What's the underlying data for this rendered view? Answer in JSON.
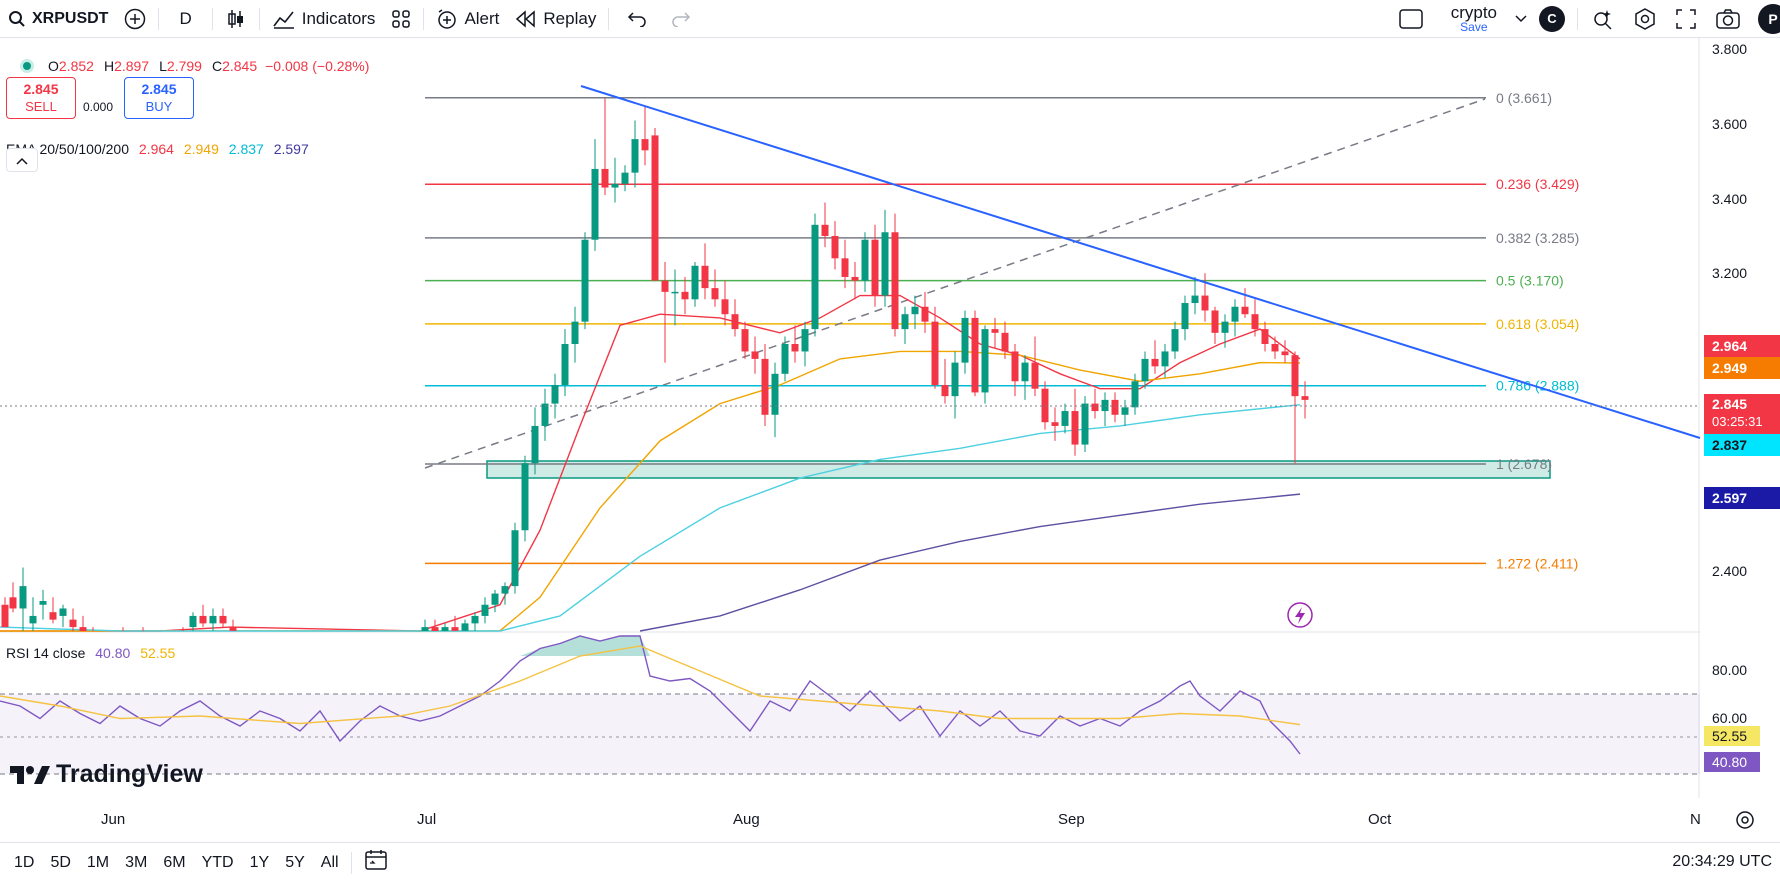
{
  "toolbar": {
    "symbol": "XRPUSDT",
    "interval": "D",
    "indicators_label": "Indicators",
    "alert_label": "Alert",
    "replay_label": "Replay",
    "layout_name": "crypto",
    "layout_save": "Save",
    "avatar_letter": "C",
    "avatar2_letter": "P"
  },
  "legend": {
    "open_label": "O",
    "open": "2.852",
    "high_label": "H",
    "high": "2.897",
    "low_label": "L",
    "low": "2.799",
    "close_label": "C",
    "close": "2.845",
    "change": "−0.008 (−0.28%)",
    "sell_price": "2.845",
    "sell_label": "SELL",
    "spread": "0.000",
    "buy_price": "2.845",
    "buy_label": "BUY",
    "ema_name": "EMA 20/50/100/200",
    "ema20": "2.964",
    "ema50": "2.949",
    "ema100": "2.837",
    "ema200": "2.597",
    "rsi_name": "RSI 14 close",
    "rsi_value": "40.80",
    "rsi_ma": "52.55",
    "collapse_icon": "chevron-up-icon"
  },
  "price_scale": {
    "labels": [
      "3.800",
      "3.600",
      "3.400",
      "3.200",
      "2.400"
    ],
    "tags": {
      "ema20": "2.964",
      "ema50": "2.949",
      "last": "2.845",
      "countdown": "03:25:31",
      "ema100": "2.837",
      "ema200": "2.597"
    },
    "rsi_labels": [
      "80.00",
      "60.00"
    ],
    "rsi_tags": {
      "ma": "52.55",
      "rsi": "40.80"
    }
  },
  "fib_levels": [
    {
      "label": "0 (3.661)",
      "color": "#787b86"
    },
    {
      "label": "0.236 (3.429)",
      "color": "#f23645"
    },
    {
      "label": "0.382 (3.285)",
      "color": "#787b86"
    },
    {
      "label": "0.5 (3.170)",
      "color": "#4caf50"
    },
    {
      "label": "0.618 (3.054)",
      "color": "#f0b400"
    },
    {
      "label": "0.786 (2.888)",
      "color": "#00bcd4"
    },
    {
      "label": "1 (2.678)",
      "color": "#787b86"
    },
    {
      "label": "1.272 (2.411)",
      "color": "#f57c00"
    }
  ],
  "time_axis": {
    "labels": [
      "Jun",
      "Jul",
      "Aug",
      "Sep",
      "Oct",
      "N"
    ]
  },
  "ranges": [
    "1D",
    "5D",
    "1M",
    "3M",
    "6M",
    "YTD",
    "1Y",
    "5Y",
    "All"
  ],
  "clock": "20:34:29 UTC",
  "brand": "TradingView",
  "colors": {
    "up": "#089981",
    "down": "#f23645",
    "trendline": "#2962ff",
    "ema20": "#f23645",
    "ema50": "#f0a500",
    "ema100": "#4dd0e1",
    "ema200": "#5e4fa2",
    "rsi": "#7e57c2",
    "rsi_ma": "#f5c242"
  }
}
